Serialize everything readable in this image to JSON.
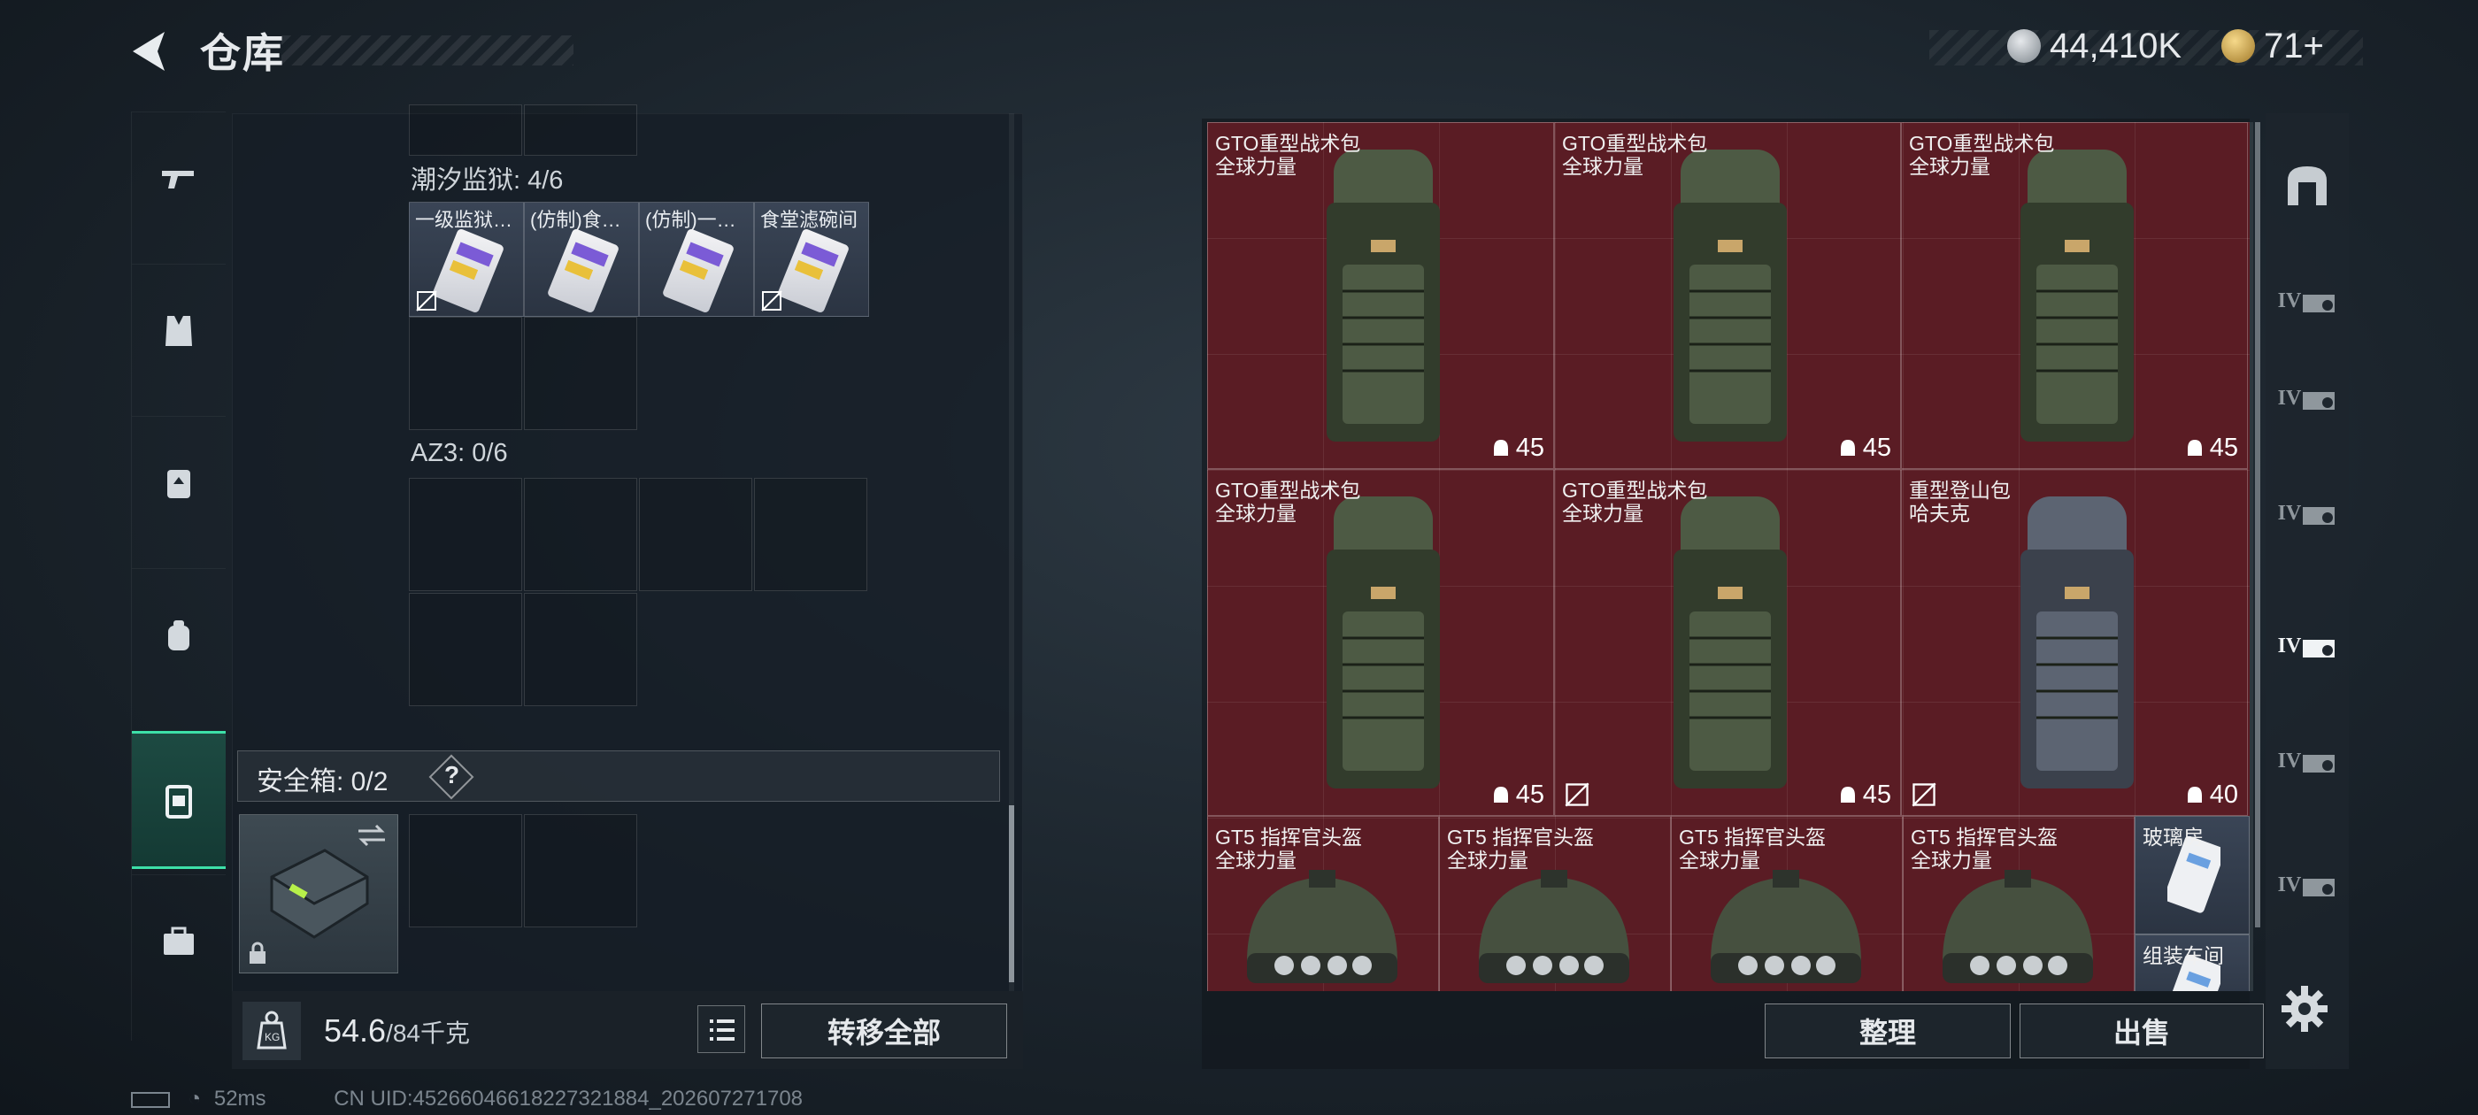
{
  "header": {
    "title": "仓库"
  },
  "currency": [
    {
      "icon": "silver-coin-icon",
      "value": "44,410K"
    },
    {
      "icon": "gold-coin-icon",
      "value": "71+"
    }
  ],
  "nav": [
    {
      "name": "nav-weapons",
      "icon": "gun-icon"
    },
    {
      "name": "nav-armor",
      "icon": "vest-icon"
    },
    {
      "name": "nav-chest-rig",
      "icon": "chest-rig-icon"
    },
    {
      "name": "nav-backpack",
      "icon": "backpack-icon"
    },
    {
      "name": "nav-secure-container",
      "icon": "container-icon"
    },
    {
      "name": "nav-toolbox",
      "icon": "toolbox-icon"
    }
  ],
  "left": {
    "section1": "潮汐监狱: 4/6",
    "section1_items": [
      {
        "name": "一级监狱…",
        "nosell": true
      },
      {
        "name": "(仿制)食…",
        "nosell": false
      },
      {
        "name": "(仿制)一…",
        "nosell": false
      },
      {
        "name": "食堂滤碗间",
        "nosell": true
      }
    ],
    "section2": "AZ3: 0/6",
    "safe_label": "安全箱: 0/2",
    "safe_help": "?",
    "weight_value": "54.6",
    "weight_max": "/84千克",
    "transfer_all": "转移全部"
  },
  "status": {
    "ping": "52ms",
    "uid": "CN UID:4526604661822732188​4_202607271708"
  },
  "grid_items": [
    {
      "n1": "GTO重型战术包",
      "n2": "全球力量",
      "dur": "45",
      "nosell": false,
      "type": "pack",
      "color": "green"
    },
    {
      "n1": "GTO重型战术包",
      "n2": "全球力量",
      "dur": "45",
      "nosell": false,
      "type": "pack",
      "color": "green"
    },
    {
      "n1": "GTO重型战术包",
      "n2": "全球力量",
      "dur": "45",
      "nosell": false,
      "type": "pack",
      "color": "green"
    },
    {
      "n1": "GTO重型战术包",
      "n2": "全球力量",
      "dur": "45",
      "nosell": false,
      "type": "pack",
      "color": "green"
    },
    {
      "n1": "GTO重型战术包",
      "n2": "全球力量",
      "dur": "45",
      "nosell": true,
      "type": "pack",
      "color": "green"
    },
    {
      "n1": "重型登山包",
      "n2": "哈夫克",
      "dur": "40",
      "nosell": true,
      "type": "pack",
      "color": "gray"
    },
    {
      "n1": "GT5 指挥官头盔",
      "n2": "全球力量",
      "type": "helmet"
    },
    {
      "n1": "GT5 指挥官头盔",
      "n2": "全球力量",
      "type": "helmet"
    },
    {
      "n1": "GT5 指挥官头盔",
      "n2": "全球力量",
      "type": "helmet"
    },
    {
      "n1": "GT5 指挥官头盔",
      "n2": "全球力量",
      "type": "helmet"
    },
    {
      "n1": "玻璃房",
      "type": "card"
    },
    {
      "n1": "组装车间",
      "type": "card"
    }
  ],
  "actions": {
    "organize": "整理",
    "sell": "出售"
  },
  "right_nav": [
    "IV",
    "IV",
    "IV",
    "IV",
    "IV",
    "IV"
  ]
}
